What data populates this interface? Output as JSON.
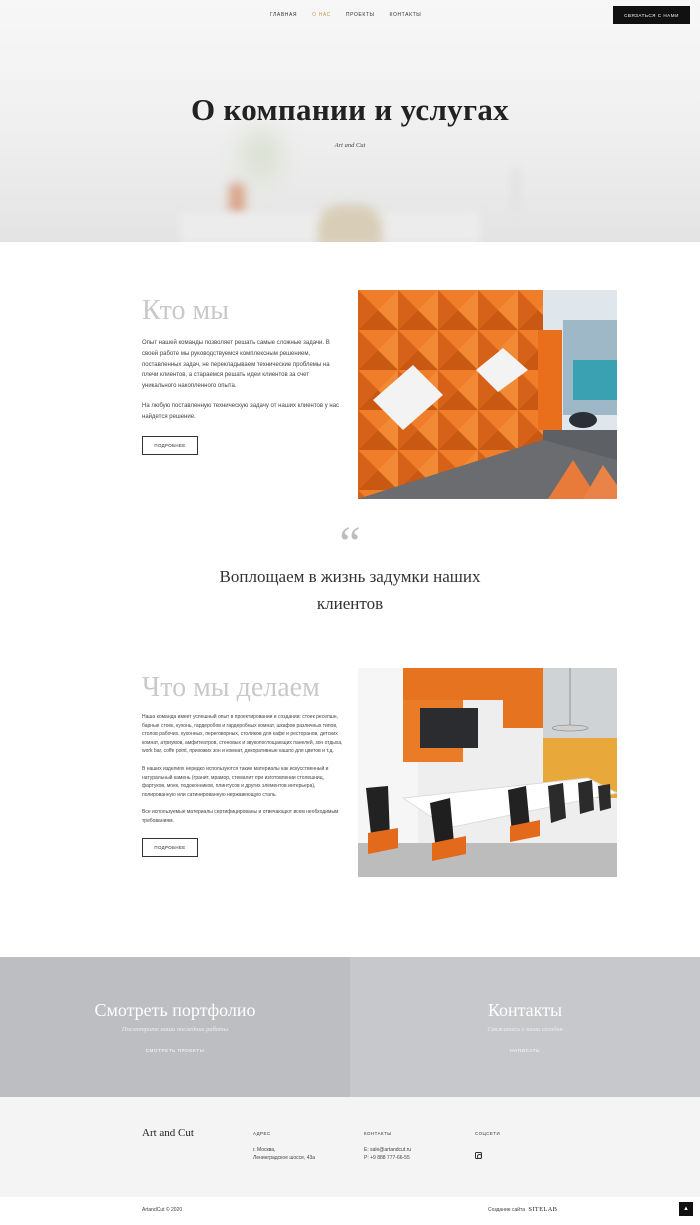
{
  "nav": {
    "items": [
      {
        "label": "ГЛАВНАЯ"
      },
      {
        "label": "О НАС"
      },
      {
        "label": "ПРОЕКТЫ"
      },
      {
        "label": "КОНТАКТЫ"
      }
    ],
    "active_index": 1,
    "contact_button": "СВЯЗАТЬСЯ С НАМИ"
  },
  "hero": {
    "title": "О компании и услугах",
    "subtitle": "Art and Cut"
  },
  "who": {
    "title": "Кто мы",
    "p1": "Опыт нашей команды позволяет решать самые сложные задачи. В своей работе мы руководствуемся комплексным решением, поставленных задач, не перекладываем технические проблемы на плечи клиентов, а стараемся решать идеи клиентов за счет уникального накопленного опыта.",
    "p2": "На любую поставленную техническую задачу от наших клиентов у нас найдется решение.",
    "button": "ПОДРОБНЕЕ"
  },
  "quote": {
    "mark": "“",
    "text": "Воплощаем в жизнь задумки наших клиентов"
  },
  "what": {
    "title": "Что мы делаем",
    "p1": "Наша команда имеет успешный опыт в проектировании и создании: стоек ресепшн, барные стоек, кухонь, гардеробов и гардеробных комнат, шкафов различных типов, столов рабочих, кухонных, переговорных, столиков для кафе и ресторанов, детских комнат, атриумов, амфитеатров, стеновых и звукопоглощающих панелей, зон отдыха, work bar, coffe point, прихожих зон и комнат, декоративные кашпо для цветов и т.д.",
    "p2": "В наших изделиях нередко используются такие материалы как искусственный и натуральный камень (гранит, мрамор, стемалит при изготовлении столешниц, фартуков, моек, подоконников, плинтусов и других элементов интерьера), полированную или сатинированную нержавеющую сталь.",
    "p3": "Все используемые материалы сертифицированы и отвечающют всем необходимым требованиям.",
    "button": "ПОДРОБНЕЕ"
  },
  "panels": {
    "portfolio": {
      "title": "Смотреть портфолио",
      "subtitle": "Посмотрите наши последние работы",
      "link": "СМОТРЕТЬ ПРОЕКТЫ"
    },
    "contacts": {
      "title": "Контакты",
      "subtitle": "Свяжитесь с нами сегодня",
      "link": "НАПИСАТЬ"
    }
  },
  "footer": {
    "brand": "Art and Cut",
    "address_heading": "АДРЕС",
    "address_line1": "г. Москва,",
    "address_line2": "Ленинградское шоссе, 43а",
    "contacts_heading": "КОНТАКТЫ",
    "email": "E: sale@artandcut.ru",
    "phone": "P: +9 888 777-66-55",
    "social_heading": "СОЦСЕТИ",
    "social_icon": "instagram-icon",
    "copyright": "ArtandCut © 2020",
    "made_by_label": "Создание сайта",
    "made_by_logo": "SITELAB",
    "up_icon": "arrow-up-icon"
  },
  "colors": {
    "accent": "#c89a52",
    "dark": "#111111",
    "panel_left": "#bcbec1",
    "panel_right": "#c7c8cb",
    "orange": "#e8701e"
  }
}
